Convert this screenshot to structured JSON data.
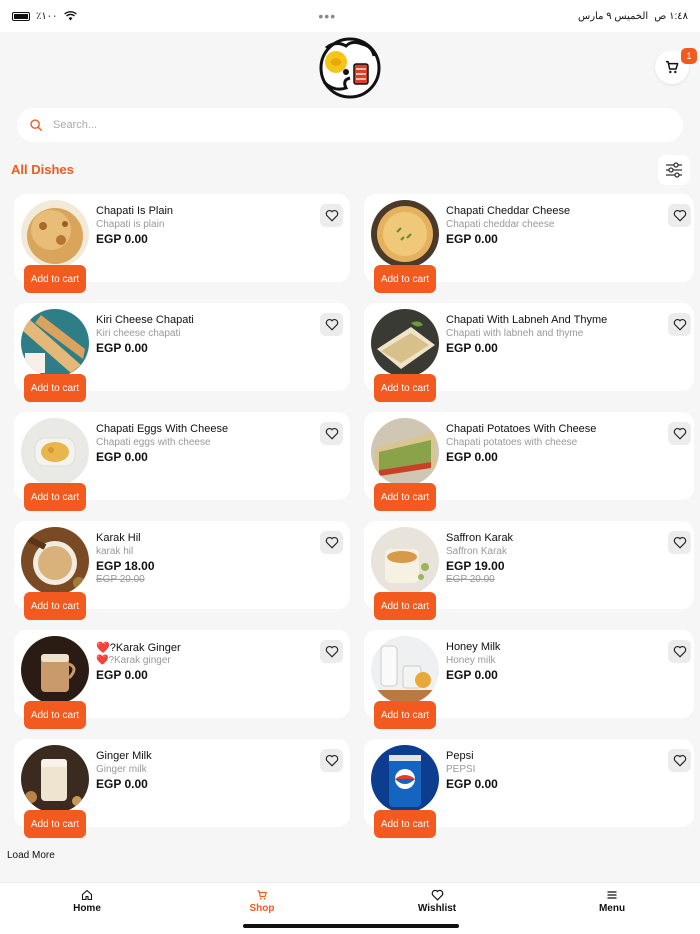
{
  "status": {
    "battery": "٪١٠٠",
    "time": "١:٤٨ ص",
    "date": "الخميس ٩ مارس"
  },
  "header": {
    "cart_count": "1"
  },
  "search": {
    "placeholder": "Search..."
  },
  "section": {
    "title": "All Dishes"
  },
  "colors": {
    "accent": "#f25a1f",
    "card": "#ffffff",
    "background": "#f6f6f6"
  },
  "dishes": [
    {
      "name": "Chapati Is Plain",
      "desc": "Chapati is plain",
      "price": "EGP 0.00",
      "old_price": "",
      "add_label": "Add to cart"
    },
    {
      "name": "Chapati Cheddar Cheese",
      "desc": "Chapati cheddar cheese",
      "price": "EGP 0.00",
      "old_price": "",
      "add_label": "Add to cart"
    },
    {
      "name": "Kiri Cheese Chapati",
      "desc": "Kiri cheese chapati",
      "price": "EGP 0.00",
      "old_price": "",
      "add_label": "Add to cart"
    },
    {
      "name": "Chapati With Labneh And Thyme",
      "desc": "Chapati with labneh and thyme",
      "price": "EGP 0.00",
      "old_price": "",
      "add_label": "Add to cart"
    },
    {
      "name": "Chapati Eggs With Cheese",
      "desc": "Chapati eggs with cheese",
      "price": "EGP 0.00",
      "old_price": "",
      "add_label": "Add to cart"
    },
    {
      "name": "Chapati Potatoes With Cheese",
      "desc": "Chapati potatoes with cheese",
      "price": "EGP 0.00",
      "old_price": "",
      "add_label": "Add to cart"
    },
    {
      "name": "Karak Hil",
      "desc": "karak hil",
      "price": "EGP 18.00",
      "old_price": "EGP 20.00",
      "add_label": "Add to cart"
    },
    {
      "name": "Saffron Karak",
      "desc": "Saffron Karak",
      "price": "EGP 19.00",
      "old_price": "EGP 20.00",
      "add_label": "Add to cart"
    },
    {
      "name": "❤️?Karak Ginger",
      "desc": "❤️?Karak ginger",
      "price": "EGP 0.00",
      "old_price": "",
      "add_label": "Add to cart"
    },
    {
      "name": "Honey Milk",
      "desc": "Honey milk",
      "price": "EGP 0.00",
      "old_price": "",
      "add_label": "Add to cart"
    },
    {
      "name": "Ginger Milk",
      "desc": "Ginger milk",
      "price": "EGP 0.00",
      "old_price": "",
      "add_label": "Add to cart"
    },
    {
      "name": "Pepsi",
      "desc": "PEPSI",
      "price": "EGP 0.00",
      "old_price": "",
      "add_label": "Add to cart"
    }
  ],
  "load_more": "Load More",
  "nav": [
    {
      "label": "Home",
      "icon": "home-icon"
    },
    {
      "label": "Shop",
      "icon": "cart-icon"
    },
    {
      "label": "Wishlist",
      "icon": "heart-icon"
    },
    {
      "label": "Menu",
      "icon": "menu-icon"
    }
  ]
}
